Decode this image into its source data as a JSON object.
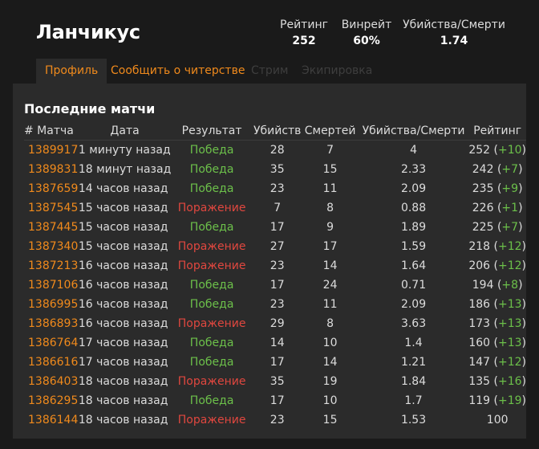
{
  "player": {
    "name": "Ланчикус"
  },
  "stats": {
    "rating_label": "Рейтинг",
    "rating_value": "252",
    "winrate_label": "Винрейт",
    "winrate_value": "60%",
    "kd_label": "Убийства/Смерти",
    "kd_value": "1.74"
  },
  "tabs": [
    {
      "label": "Профиль",
      "active": true
    },
    {
      "label": "Сообщить о читерстве",
      "active": false
    },
    {
      "label": "Стрим",
      "active": false,
      "disabled": true
    },
    {
      "label": "Экипировка",
      "active": false,
      "disabled": true
    }
  ],
  "matches": {
    "title": "Последние матчи",
    "headers": {
      "id": "# Матча",
      "date": "Дата",
      "result": "Результат",
      "kills": "Убийств",
      "deaths": "Смертей",
      "kd": "Убийства/Смерти",
      "rating": "Рейтинг"
    },
    "colors": {
      "win": "#6cc04a",
      "loss": "#e0473f",
      "link": "#f08a1c"
    },
    "rows": [
      {
        "id": "1389917",
        "date": "1 минуту назад",
        "result": "Победа",
        "win": true,
        "kills": "28",
        "deaths": "7",
        "kd": "4",
        "rating": "252",
        "delta": "+10"
      },
      {
        "id": "1389831",
        "date": "18 минут назад",
        "result": "Победа",
        "win": true,
        "kills": "35",
        "deaths": "15",
        "kd": "2.33",
        "rating": "242",
        "delta": "+7"
      },
      {
        "id": "1387659",
        "date": "14 часов назад",
        "result": "Победа",
        "win": true,
        "kills": "23",
        "deaths": "11",
        "kd": "2.09",
        "rating": "235",
        "delta": "+9"
      },
      {
        "id": "1387545",
        "date": "15 часов назад",
        "result": "Поражение",
        "win": false,
        "kills": "7",
        "deaths": "8",
        "kd": "0.88",
        "rating": "226",
        "delta": "+1"
      },
      {
        "id": "1387445",
        "date": "15 часов назад",
        "result": "Победа",
        "win": true,
        "kills": "17",
        "deaths": "9",
        "kd": "1.89",
        "rating": "225",
        "delta": "+7"
      },
      {
        "id": "1387340",
        "date": "15 часов назад",
        "result": "Поражение",
        "win": false,
        "kills": "27",
        "deaths": "17",
        "kd": "1.59",
        "rating": "218",
        "delta": "+12"
      },
      {
        "id": "1387213",
        "date": "16 часов назад",
        "result": "Поражение",
        "win": false,
        "kills": "23",
        "deaths": "14",
        "kd": "1.64",
        "rating": "206",
        "delta": "+12"
      },
      {
        "id": "1387106",
        "date": "16 часов назад",
        "result": "Победа",
        "win": true,
        "kills": "17",
        "deaths": "24",
        "kd": "0.71",
        "rating": "194",
        "delta": "+8"
      },
      {
        "id": "1386995",
        "date": "16 часов назад",
        "result": "Победа",
        "win": true,
        "kills": "23",
        "deaths": "11",
        "kd": "2.09",
        "rating": "186",
        "delta": "+13"
      },
      {
        "id": "1386893",
        "date": "16 часов назад",
        "result": "Поражение",
        "win": false,
        "kills": "29",
        "deaths": "8",
        "kd": "3.63",
        "rating": "173",
        "delta": "+13"
      },
      {
        "id": "1386764",
        "date": "17 часов назад",
        "result": "Победа",
        "win": true,
        "kills": "14",
        "deaths": "10",
        "kd": "1.4",
        "rating": "160",
        "delta": "+13"
      },
      {
        "id": "1386616",
        "date": "17 часов назад",
        "result": "Победа",
        "win": true,
        "kills": "17",
        "deaths": "14",
        "kd": "1.21",
        "rating": "147",
        "delta": "+12"
      },
      {
        "id": "1386403",
        "date": "18 часов назад",
        "result": "Поражение",
        "win": false,
        "kills": "35",
        "deaths": "19",
        "kd": "1.84",
        "rating": "135",
        "delta": "+16"
      },
      {
        "id": "1386295",
        "date": "18 часов назад",
        "result": "Победа",
        "win": true,
        "kills": "17",
        "deaths": "10",
        "kd": "1.7",
        "rating": "119",
        "delta": "+19"
      },
      {
        "id": "1386144",
        "date": "18 часов назад",
        "result": "Поражение",
        "win": false,
        "kills": "23",
        "deaths": "15",
        "kd": "1.53",
        "rating": "100",
        "delta": ""
      }
    ]
  }
}
